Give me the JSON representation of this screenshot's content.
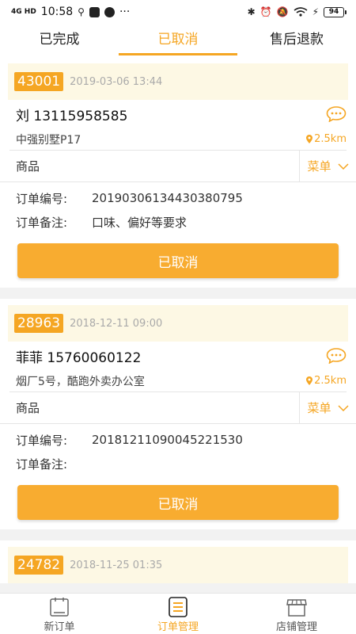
{
  "status_bar": {
    "signal": "4G HD",
    "time": "10:58",
    "extra": "···",
    "battery": "94"
  },
  "tabs": [
    {
      "label": "已完成",
      "active": false
    },
    {
      "label": "已取消",
      "active": true
    },
    {
      "label": "售后退款",
      "active": false
    }
  ],
  "orders": [
    {
      "number": "43001",
      "time": "2019-03-06 13:44",
      "customer": "刘 13115958585",
      "address": "中强别墅P17",
      "distance": "2.5km",
      "goods_label": "商品",
      "menu_label": "菜单",
      "order_no_label": "订单编号:",
      "order_no": "20190306134430380795",
      "remark_label": "订单备注:",
      "remark": "口味、偏好等要求",
      "button": "已取消"
    },
    {
      "number": "28963",
      "time": "2018-12-11 09:00",
      "customer": "菲菲 15760060122",
      "address": "烟厂5号，酷跑外卖办公室",
      "distance": "2.5km",
      "goods_label": "商品",
      "menu_label": "菜单",
      "order_no_label": "订单编号:",
      "order_no": "20181211090045221530",
      "remark_label": "订单备注:",
      "remark": "",
      "button": "已取消"
    },
    {
      "number": "24782",
      "time": "2018-11-25 01:35"
    }
  ],
  "bottom_nav": [
    {
      "label": "新订单",
      "icon": "new-order-icon",
      "active": false
    },
    {
      "label": "订单管理",
      "icon": "order-manage-icon",
      "active": true
    },
    {
      "label": "店铺管理",
      "icon": "shop-icon",
      "active": false
    }
  ],
  "colors": {
    "accent": "#f5a623",
    "head_bg": "#fdf8e4"
  }
}
